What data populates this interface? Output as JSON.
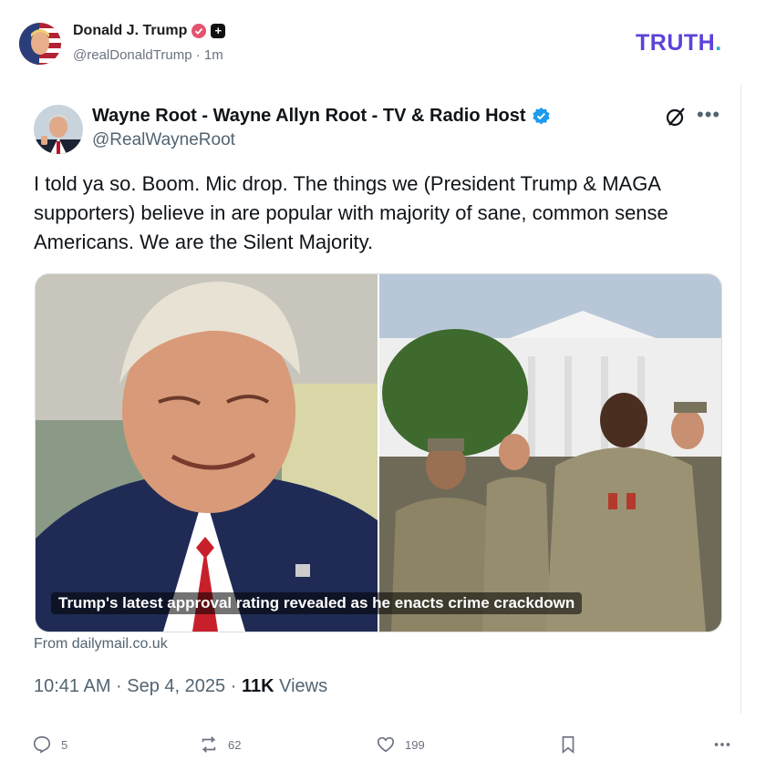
{
  "outer_post": {
    "display_name": "Donald J. Trump",
    "handle": "@realDonaldTrump",
    "separator": "·",
    "time": "1m",
    "logo_main": "TRUTH",
    "logo_dot": ".",
    "logo_colors": {
      "text": "#5b43d8",
      "dot": "#1fb3c8"
    },
    "verified_badge_color": "#e5536e"
  },
  "embedded_tweet": {
    "display_name": "Wayne Root - Wayne Allyn Root - TV & Radio Host",
    "handle": "@RealWayneRoot",
    "verified_badge_color": "#1d9bf0",
    "text": "I told ya so. Boom. Mic drop. The things we (President Trump & MAGA supporters) believe in are popular with majority of sane, common sense Americans. We are the Silent Majority.",
    "media_caption": "Trump's latest approval rating revealed as he enacts crime crackdown",
    "source": "From dailymail.co.uk",
    "timestamp": "10:41 AM · Sep 4, 2025",
    "separator": " · ",
    "views_count": "11K",
    "views_label": "Views",
    "icons": {
      "grok": "grok-slash-icon",
      "more": "more-horizontal-icon"
    }
  },
  "actions": {
    "replies": "5",
    "reposts": "62",
    "likes": "199",
    "icons": [
      "reply-icon",
      "repost-icon",
      "like-icon",
      "bookmark-icon",
      "more-icon"
    ]
  }
}
